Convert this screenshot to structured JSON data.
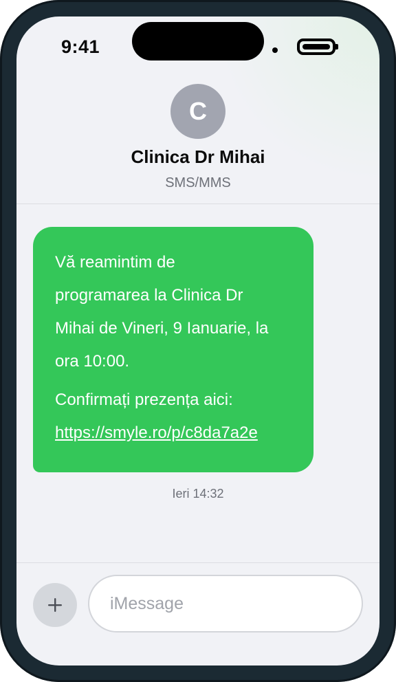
{
  "status_bar": {
    "time": "9:41"
  },
  "contact": {
    "initial": "C",
    "name": "Clinica Dr Mihai",
    "channel": "SMS/MMS"
  },
  "messages": [
    {
      "lines": [
        "Vă reamintim de",
        "programarea la Clinica Dr",
        "Mihai de Vineri, 9 Ianuarie, la",
        "ora 10:00."
      ],
      "confirm_text": "Confirmați prezența aici:",
      "link": "https://smyle.ro/p/c8da7a2e",
      "timestamp": "Ieri 14:32"
    }
  ],
  "composer": {
    "placeholder": "iMessage",
    "value": ""
  },
  "colors": {
    "bubble": "#34c759",
    "frame": "#1b2a33",
    "screen_bg": "#f1f2f6",
    "avatar": "#a2a5b0"
  },
  "icons": {
    "add": "plus-icon",
    "battery": "battery-icon"
  }
}
